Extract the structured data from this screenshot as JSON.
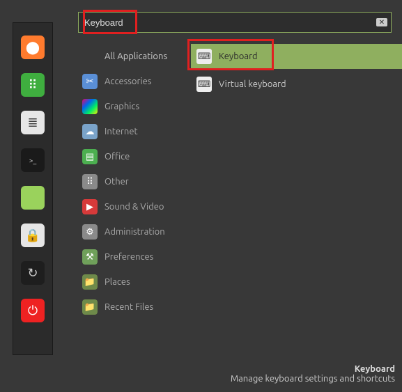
{
  "search": {
    "value": "Keyboard",
    "clear_symbol": "✕"
  },
  "categories": [
    {
      "label": "All Applications",
      "id": "all",
      "icon_bg": "transparent",
      "glyph": ""
    },
    {
      "label": "Accessories",
      "id": "accessories",
      "icon_bg": "#5a8fd6",
      "glyph": "✂"
    },
    {
      "label": "Graphics",
      "id": "graphics",
      "icon_bg": "linear-gradient(135deg,#e06,#06e,#0e6,#ee0)",
      "glyph": ""
    },
    {
      "label": "Internet",
      "id": "internet",
      "icon_bg": "#7aa3c9",
      "glyph": "☁"
    },
    {
      "label": "Office",
      "id": "office",
      "icon_bg": "#4caf50",
      "glyph": "▤"
    },
    {
      "label": "Other",
      "id": "other",
      "icon_bg": "#8a8a8a",
      "glyph": "⠿"
    },
    {
      "label": "Sound & Video",
      "id": "sound",
      "icon_bg": "#d63a3a",
      "glyph": "▶"
    },
    {
      "label": "Administration",
      "id": "admin",
      "icon_bg": "#8a8a8a",
      "glyph": "⚙"
    },
    {
      "label": "Preferences",
      "id": "prefs",
      "icon_bg": "#6fa05a",
      "glyph": "⚒"
    },
    {
      "label": "Places",
      "id": "places",
      "icon_bg": "#6e8a4a",
      "glyph": "📁"
    },
    {
      "label": "Recent Files",
      "id": "recent",
      "icon_bg": "#6e8a4a",
      "glyph": "📁"
    }
  ],
  "results": [
    {
      "label": "Keyboard",
      "id": "keyboard",
      "glyph": "⌨",
      "selected": true,
      "highlighted": true
    },
    {
      "label": "Virtual keyboard",
      "id": "virtual-keyboard",
      "glyph": "⌨",
      "selected": false,
      "highlighted": false
    }
  ],
  "description": {
    "title": "Keyboard",
    "subtitle": "Manage keyboard settings and shortcuts"
  },
  "dock": [
    {
      "id": "firefox",
      "bg": "#ff7b2e",
      "glyph": "⬤",
      "color": "#fff"
    },
    {
      "id": "apps",
      "bg": "#3fae3f",
      "glyph": "⠿",
      "color": "#fff"
    },
    {
      "id": "settings",
      "bg": "#e6e6e6",
      "glyph": "≣",
      "color": "#444"
    },
    {
      "id": "terminal",
      "bg": "#1a1a1a",
      "glyph": ">_",
      "color": "#ccc"
    },
    {
      "id": "files",
      "bg": "#9ad25c",
      "glyph": "",
      "color": "#fff"
    },
    {
      "id": "lock",
      "bg": "#e6e6e6",
      "glyph": "🔒",
      "color": "#222"
    },
    {
      "id": "logout",
      "bg": "#1e1e1e",
      "glyph": "↻",
      "color": "#ccc"
    },
    {
      "id": "power",
      "bg": "#e22",
      "glyph": "⏻",
      "color": "#fff"
    }
  ]
}
